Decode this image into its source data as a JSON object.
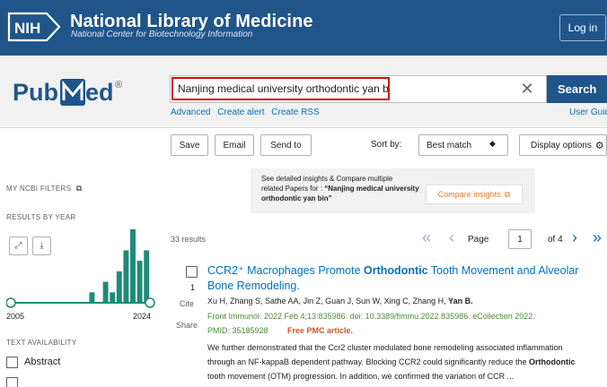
{
  "header": {
    "logo_text": "NIH",
    "title": "National Library of Medicine",
    "subtitle": "National Center for Biotechnology Information",
    "login_label": "Log in",
    "brand_color": "#20558a"
  },
  "search": {
    "logo_text": "PubMed",
    "logo_mark": "®",
    "query": "Nanjing medical university orthodontic yan bin",
    "button_label": "Search",
    "links": [
      "Advanced",
      "Create alert",
      "Create RSS"
    ],
    "user_guide": "User Guid",
    "highlight_color": "#d20c0c"
  },
  "toolbar": {
    "save_label": "Save",
    "email_label": "Email",
    "send_to_label": "Send to",
    "sort_by_label": "Sort by:",
    "sort_value": "Best match",
    "display_options_label": "Display options"
  },
  "sidebar": {
    "filters_label": "MY NCBI FILTERS",
    "results_by_year_label": "RESULTS BY YEAR",
    "year_start": "2005",
    "year_end": "2024",
    "text_availability_label": "TEXT AVAILABILITY",
    "abstract_label": "Abstract",
    "accent_color": "#1f8a78"
  },
  "insights": {
    "line1": "See detailed insights & Compare multiple",
    "line2": "related Papers for :",
    "query_quote": "“Nanjing medical university orthodontic yan bin”",
    "button_label": "Compare insights"
  },
  "results": {
    "count_label": "33 results",
    "page_label": "Page",
    "page_value": "1",
    "of_label": "of 4"
  },
  "article": {
    "number": "1",
    "cite_label": "Cite",
    "share_label": "Share",
    "title_pre": "CCR2⁺ Macrophages Promote ",
    "title_bold": "Orthodontic",
    "title_post": " Tooth Movement and Alveolar Bone Remodeling.",
    "authors_pre": "Xu H, Zhang S, Sathe AA, Jin Z, Guan J, Sun W, Xing C, Zhang H, ",
    "authors_bold": "Yan B.",
    "citation": "Front Immunol. 2022 Feb 4;13:835986. doi: 10.3389/fimmu.2022.835986. eCollection 2022.",
    "pmid": "PMID: 35185928",
    "free_pmc": "Free PMC article.",
    "snippet_line1": "We further demonstrated that the Ccr2 cluster modulated bone remodeling associated inflammation",
    "snippet_line2_pre": "through an NF-kappaB dependent pathway. Blocking CCR2 could significantly reduce the ",
    "snippet_line2_bold": "Orthodontic",
    "snippet_line3": "tooth movement (OTM) progression. In addition, we confirmed the variation of CCR ..."
  },
  "chart_data": {
    "type": "bar",
    "x": [
      "2005",
      "2006",
      "2007",
      "2008",
      "2009",
      "2010",
      "2011",
      "2012",
      "2013",
      "2014",
      "2015",
      "2016",
      "2017",
      "2018",
      "2019",
      "2020",
      "2021",
      "2022",
      "2023",
      "2024"
    ],
    "values": [
      0,
      0,
      0,
      0,
      0,
      0,
      0,
      0,
      0,
      0,
      0,
      1,
      0,
      2,
      1,
      3,
      5,
      7,
      4,
      5
    ],
    "xlabel": "",
    "ylabel": ""
  }
}
